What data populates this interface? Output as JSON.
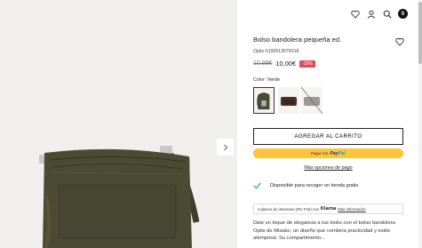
{
  "gallery": {
    "next_arrow_icon": "chevron-right-icon"
  },
  "header": {
    "icons": [
      "heart-icon",
      "user-icon",
      "search-icon",
      "bag-icon"
    ],
    "cart_count": "0"
  },
  "product": {
    "title": "Bolso bandolera pequeña ed.",
    "sku": "Optis-5100513576018",
    "old_price": "10,99€",
    "new_price": "10,00€",
    "discount": "-10%",
    "color_label": "Color:",
    "color_value": "Verde",
    "swatches": [
      "Verde",
      "Marrón",
      "Gris"
    ]
  },
  "actions": {
    "add_to_cart": "AGREGAR AL CARRITO",
    "paypal_prefix": "Pagar con",
    "paypal_brand_a": "Pay",
    "paypal_brand_b": "Pal",
    "more_payment": "Más opciones de pago"
  },
  "availability": {
    "text": "Disponible para recoger en tienda gratis"
  },
  "klarna": {
    "text": "3 plazos sin intereses (0% TAE) con",
    "brand": "Klarna",
    "link": "Más información"
  },
  "description": {
    "text": "Dale un toque de elegancia a tus looks con el bolso bandolera Optis de Misako, un diseño que combina practicidad y estilo atemporal. Su compartimento..."
  },
  "colors": {
    "bag_green": "#4b4a33",
    "paypal_yellow": "#ffc439",
    "discount_red": "#e14b5a",
    "check_green": "#2bb673"
  }
}
